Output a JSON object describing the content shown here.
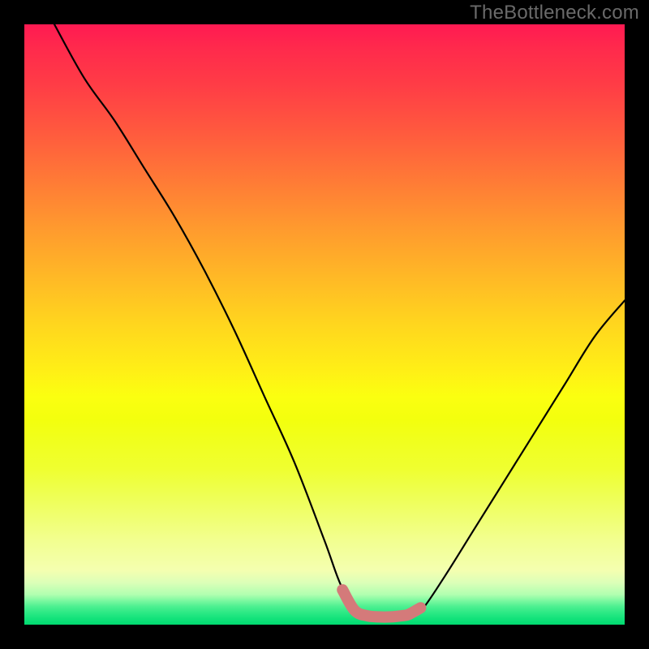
{
  "watermark": {
    "text": "TheBottleneck.com"
  },
  "colors": {
    "frame": "#000000",
    "curve": "#000000",
    "highlight": "#d47a7a"
  },
  "chart_data": {
    "type": "line",
    "title": "",
    "xlabel": "",
    "ylabel": "",
    "xlim": [
      0,
      100
    ],
    "ylim": [
      0,
      100
    ],
    "grid": false,
    "legend": false,
    "series": [
      {
        "name": "left-branch",
        "x": [
          5,
          10,
          15,
          20,
          25,
          30,
          35,
          40,
          45,
          50,
          53,
          56,
          58
        ],
        "values": [
          100,
          91,
          84,
          76,
          68,
          59,
          49,
          38,
          27,
          14,
          6,
          2.2,
          1.4
        ]
      },
      {
        "name": "right-branch",
        "x": [
          64,
          66,
          70,
          75,
          80,
          85,
          90,
          95,
          100
        ],
        "values": [
          1.4,
          2.2,
          8,
          16,
          24,
          32,
          40,
          48,
          54
        ]
      },
      {
        "name": "bottom-highlight",
        "x": [
          53,
          55,
          57,
          59,
          61,
          63,
          64,
          66
        ],
        "values": [
          5.8,
          2.4,
          1.5,
          1.3,
          1.3,
          1.5,
          1.7,
          2.8
        ]
      }
    ],
    "annotations": []
  }
}
